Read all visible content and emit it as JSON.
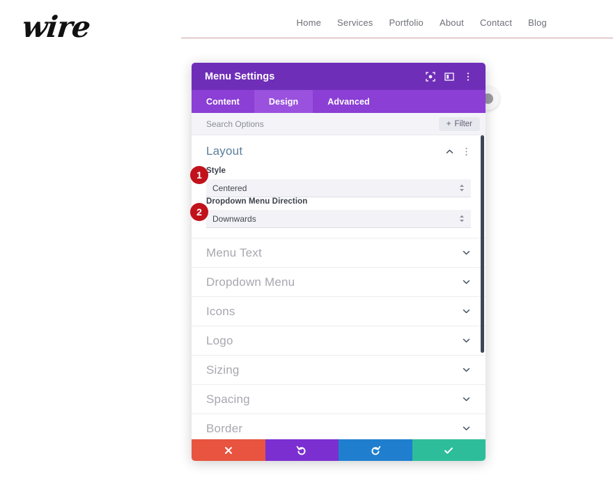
{
  "site": {
    "logo_text": "wire",
    "nav_items": [
      {
        "label": "Home"
      },
      {
        "label": "Services"
      },
      {
        "label": "Portfolio"
      },
      {
        "label": "About"
      },
      {
        "label": "Contact"
      },
      {
        "label": "Blog"
      }
    ],
    "accent_line_color": "#c9a0a0"
  },
  "modal": {
    "title": "Menu Settings",
    "header_color": "#6f2eb8",
    "tabbar_color": "#8b3fd4",
    "active_tab_color": "#9a52de",
    "header_icons": [
      {
        "name": "target-icon"
      },
      {
        "name": "layout-panel-icon"
      },
      {
        "name": "kebab-menu-icon"
      }
    ],
    "tabs": [
      {
        "label": "Content",
        "active": false
      },
      {
        "label": "Design",
        "active": true
      },
      {
        "label": "Advanced",
        "active": false
      }
    ],
    "search": {
      "placeholder": "Search Options",
      "value": "",
      "filter_label": "Filter",
      "filter_plus": "+"
    },
    "layout_section": {
      "title": "Layout",
      "expanded": true,
      "fields": [
        {
          "label": "Style",
          "value": "Centered"
        },
        {
          "label": "Dropdown Menu Direction",
          "value": "Downwards"
        }
      ]
    },
    "collapsed_sections": [
      {
        "label": "Menu Text"
      },
      {
        "label": "Dropdown Menu"
      },
      {
        "label": "Icons"
      },
      {
        "label": "Logo"
      },
      {
        "label": "Sizing"
      },
      {
        "label": "Spacing"
      },
      {
        "label": "Border"
      }
    ],
    "footer_buttons": [
      {
        "name": "cancel",
        "icon": "close-icon",
        "color": "#e8543f"
      },
      {
        "name": "undo",
        "icon": "undo-icon",
        "color": "#7b2fd1"
      },
      {
        "name": "redo",
        "icon": "redo-icon",
        "color": "#1f7fce"
      },
      {
        "name": "save",
        "icon": "check-icon",
        "color": "#2ebd9a"
      }
    ]
  },
  "annotations": [
    {
      "number": "1",
      "color": "#c1121c"
    },
    {
      "number": "2",
      "color": "#c1121c"
    }
  ]
}
